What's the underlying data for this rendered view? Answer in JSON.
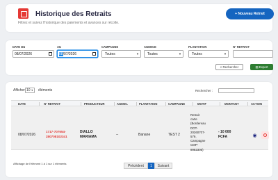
{
  "header": {
    "title": "Historique des Retraits",
    "subtitle": "Filtrez et suivez l'historique des paiements et avances sur récolte.",
    "new_button": "+ Nouveau Retrait"
  },
  "filters": {
    "date_du_label": "DATE DU",
    "date_du_value": "08/07/2026",
    "au_label": "AU",
    "au_highlight": "08",
    "au_rest": "/07/2026",
    "campagne_label": "CAMPAGNE",
    "campagne_value": "Toutes",
    "agence_label": "AGENCE",
    "agence_value": "Toutes",
    "plantation_label": "PLANTATION",
    "plantation_value": "Toutes",
    "numero_label": "N° RETRAIT",
    "numero_value": "",
    "search_button": "Rechercher",
    "export_button": "Export"
  },
  "table": {
    "show_prefix": "Afficher",
    "page_length": "10",
    "show_suffix": "éléments",
    "search_label": "Rechercher :",
    "columns": [
      "DATE",
      "N° RETRAIT",
      "PRODUCTEUR",
      "AGENC.",
      "PLANTATION",
      "CAMPAGNE",
      "MOTIF",
      "MONTANT",
      "ACTION"
    ],
    "row": {
      "date": "08/07/2026",
      "numero_line1": "1717-707654-",
      "numero_line2": "280708102341",
      "producteur_line1": "DIALLO",
      "producteur_line2": "MARIAMA",
      "agence": "--",
      "plantation": "Banane",
      "campagne": "TEST 2",
      "motif_lines": [
        "Retrait",
        "carte",
        "(Bordereau",
        "DOT-",
        "20260707-",
        "579,",
        "Campagne",
        "CMP-",
        "8982305)"
      ],
      "montant_line1": "- 10 000",
      "montant_line2": "FCFA"
    },
    "info": "Affichage de l'élément 1 à 1 sur 1 éléments",
    "pagination": {
      "previous": "Précédent",
      "current": "1",
      "next": "Suivant"
    }
  },
  "colors": {
    "primary": "#1565c0",
    "danger": "#e53935",
    "success": "#2e7d32"
  },
  "icons": [
    "receipt-icon",
    "calendar-icon",
    "search-icon",
    "excel-icon",
    "eye-icon",
    "cancel-icon"
  ]
}
